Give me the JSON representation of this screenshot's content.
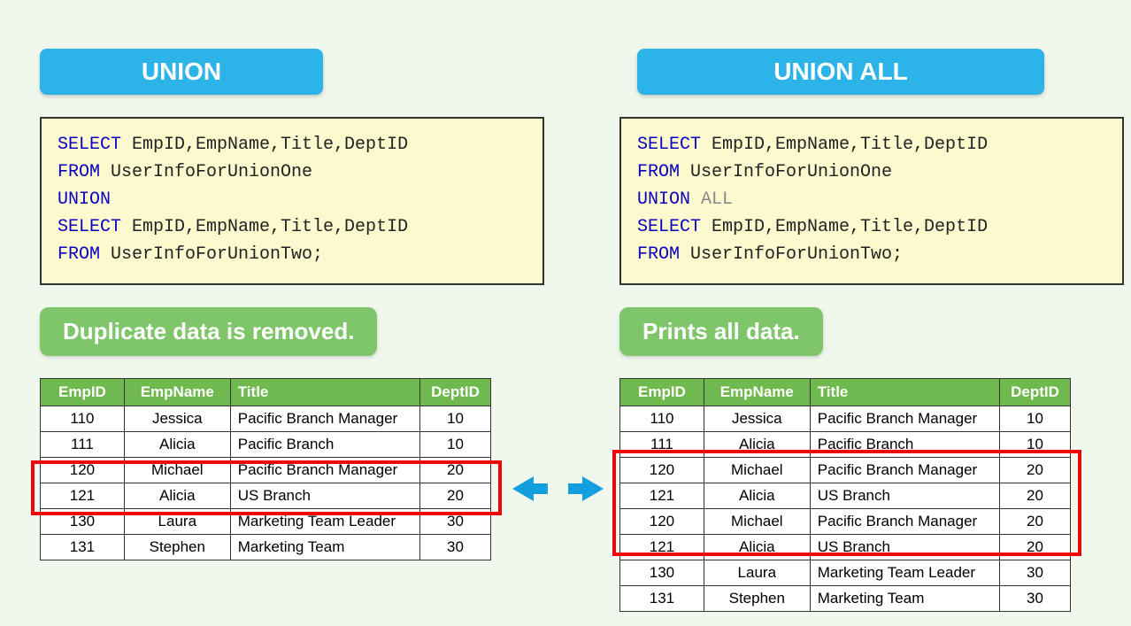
{
  "left": {
    "pill": "UNION",
    "sql": {
      "l1a": "SELECT",
      "l1b": " EmpID,EmpName,Title,DeptID",
      "l2a": "FROM",
      "l2b": " UserInfoForUnionOne",
      "l3a": "UNION",
      "l4a": "SELECT",
      "l4b": " EmpID,EmpName,Title,DeptID",
      "l5a": "FROM",
      "l5b": " UserInfoForUnionTwo;"
    },
    "note": "Duplicate data is removed.",
    "headers": [
      "EmpID",
      "EmpName",
      "Title",
      "DeptID"
    ],
    "rows": [
      {
        "id": "110",
        "name": "Jessica",
        "title": "Pacific Branch Manager",
        "dept": "10"
      },
      {
        "id": "111",
        "name": "Alicia",
        "title": "Pacific Branch",
        "dept": "10"
      },
      {
        "id": "120",
        "name": "Michael",
        "title": "Pacific Branch Manager",
        "dept": "20"
      },
      {
        "id": "121",
        "name": "Alicia",
        "title": "US Branch",
        "dept": "20"
      },
      {
        "id": "130",
        "name": "Laura",
        "title": "Marketing Team Leader",
        "dept": "30"
      },
      {
        "id": "131",
        "name": "Stephen",
        "title": "Marketing Team",
        "dept": "30"
      }
    ]
  },
  "right": {
    "pill": "UNION ALL",
    "sql": {
      "l1a": "SELECT",
      "l1b": " EmpID,EmpName,Title,DeptID",
      "l2a": "FROM",
      "l2b": " UserInfoForUnionOne",
      "l3a": "UNION",
      "l3b": " ALL",
      "l4a": "SELECT",
      "l4b": " EmpID,EmpName,Title,DeptID",
      "l5a": "FROM",
      "l5b": " UserInfoForUnionTwo;"
    },
    "note": "Prints all data.",
    "headers": [
      "EmpID",
      "EmpName",
      "Title",
      "DeptID"
    ],
    "rows": [
      {
        "id": "110",
        "name": "Jessica",
        "title": "Pacific Branch Manager",
        "dept": "10"
      },
      {
        "id": "111",
        "name": "Alicia",
        "title": "Pacific Branch",
        "dept": "10"
      },
      {
        "id": "120",
        "name": "Michael",
        "title": "Pacific Branch Manager",
        "dept": "20"
      },
      {
        "id": "121",
        "name": "Alicia",
        "title": "US Branch",
        "dept": "20"
      },
      {
        "id": "120",
        "name": "Michael",
        "title": "Pacific Branch Manager",
        "dept": "20"
      },
      {
        "id": "121",
        "name": "Alicia",
        "title": "US Branch",
        "dept": "20"
      },
      {
        "id": "130",
        "name": "Laura",
        "title": "Marketing Team Leader",
        "dept": "30"
      },
      {
        "id": "131",
        "name": "Stephen",
        "title": "Marketing Team",
        "dept": "30"
      }
    ]
  }
}
